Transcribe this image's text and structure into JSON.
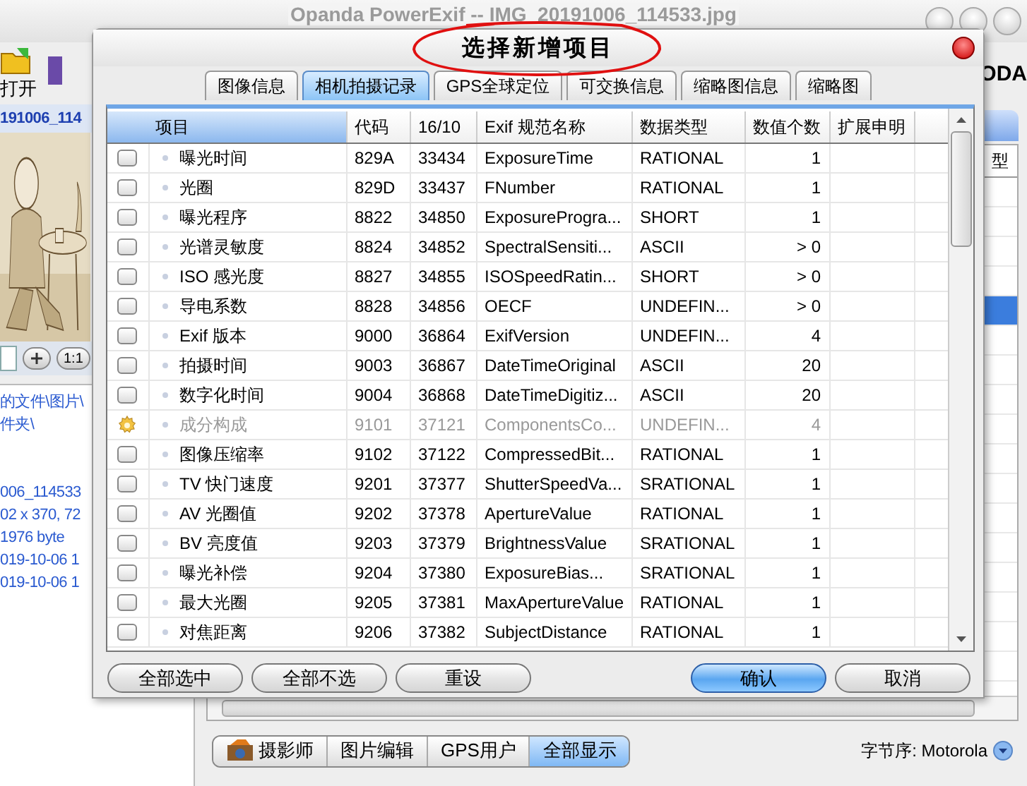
{
  "app_window": {
    "title": "Opanda PowerExif -- IMG_20191006_114533.jpg",
    "toolbar": [
      {
        "label": "打开"
      }
    ],
    "logo": "ODA",
    "file_name": "191006_114",
    "zoom_controls": [
      {
        "label": "1:1"
      }
    ],
    "file_path": [
      "的文件\\图片\\",
      "件夹\\"
    ],
    "file_details": [
      "006_114533",
      "02 x 370, 72",
      "1976 byte",
      "019-10-06 1",
      "019-10-06 1"
    ],
    "list_header": "型",
    "list_rows": [
      {
        "selected": false
      },
      {
        "selected": false
      },
      {
        "selected": false
      },
      {
        "selected": false
      },
      {
        "selected": true
      },
      {
        "selected": false
      },
      {
        "selected": false
      },
      {
        "selected": false
      },
      {
        "selected": false
      },
      {
        "selected": false
      },
      {
        "selected": false
      },
      {
        "selected": false
      },
      {
        "selected": false
      },
      {
        "selected": false
      },
      {
        "selected": false
      },
      {
        "selected": false
      },
      {
        "selected": false
      }
    ],
    "view_tabs": [
      {
        "label": "摄影师",
        "selected": false,
        "icon": true
      },
      {
        "label": "图片编辑",
        "selected": false,
        "icon": false
      },
      {
        "label": "GPS用户",
        "selected": false,
        "icon": false
      },
      {
        "label": "全部显示",
        "selected": true,
        "icon": false
      }
    ],
    "byte_order": "字节序: Motorola"
  },
  "dialog": {
    "title": "选择新增项目",
    "tabs": [
      {
        "label": "图像信息",
        "selected": false
      },
      {
        "label": "相机拍摄记录",
        "selected": true
      },
      {
        "label": "GPS全球定位",
        "selected": false
      },
      {
        "label": "可交换信息",
        "selected": false
      },
      {
        "label": "缩略图信息",
        "selected": false
      },
      {
        "label": "缩略图",
        "selected": false
      }
    ],
    "columns": [
      "项目",
      "代码",
      "16/10",
      "Exif 规范名称",
      "数据类型",
      "数值个数",
      "扩展申明"
    ],
    "rows": [
      {
        "item": "曝光时间",
        "code": "829A",
        "decimal": "33434",
        "exif_name": "ExposureTime",
        "data_type": "RATIONAL",
        "count": "1",
        "checked": false,
        "disabled": false
      },
      {
        "item": "光圈",
        "code": "829D",
        "decimal": "33437",
        "exif_name": "FNumber",
        "data_type": "RATIONAL",
        "count": "1",
        "checked": false,
        "disabled": false
      },
      {
        "item": "曝光程序",
        "code": "8822",
        "decimal": "34850",
        "exif_name": "ExposureProgra...",
        "data_type": "SHORT",
        "count": "1",
        "checked": false,
        "disabled": false
      },
      {
        "item": "光谱灵敏度",
        "code": "8824",
        "decimal": "34852",
        "exif_name": "SpectralSensiti...",
        "data_type": "ASCII",
        "count": "> 0",
        "checked": false,
        "disabled": false
      },
      {
        "item": "ISO 感光度",
        "code": "8827",
        "decimal": "34855",
        "exif_name": "ISOSpeedRatin...",
        "data_type": "SHORT",
        "count": "> 0",
        "checked": false,
        "disabled": false
      },
      {
        "item": "导电系数",
        "code": "8828",
        "decimal": "34856",
        "exif_name": "OECF",
        "data_type": "UNDEFIN...",
        "count": "> 0",
        "checked": false,
        "disabled": false
      },
      {
        "item": "Exif 版本",
        "code": "9000",
        "decimal": "36864",
        "exif_name": "ExifVersion",
        "data_type": "UNDEFIN...",
        "count": "4",
        "checked": false,
        "disabled": false
      },
      {
        "item": "拍摄时间",
        "code": "9003",
        "decimal": "36867",
        "exif_name": "DateTimeOriginal",
        "data_type": "ASCII",
        "count": "20",
        "checked": false,
        "disabled": false
      },
      {
        "item": "数字化时间",
        "code": "9004",
        "decimal": "36868",
        "exif_name": "DateTimeDigitiz...",
        "data_type": "ASCII",
        "count": "20",
        "checked": false,
        "disabled": false
      },
      {
        "item": "成分构成",
        "code": "9101",
        "decimal": "37121",
        "exif_name": "ComponentsCo...",
        "data_type": "UNDEFIN...",
        "count": "4",
        "checked": false,
        "disabled": true
      },
      {
        "item": "图像压缩率",
        "code": "9102",
        "decimal": "37122",
        "exif_name": "CompressedBit...",
        "data_type": "RATIONAL",
        "count": "1",
        "checked": false,
        "disabled": false
      },
      {
        "item": "TV 快门速度",
        "code": "9201",
        "decimal": "37377",
        "exif_name": "ShutterSpeedVa...",
        "data_type": "SRATIONAL",
        "count": "1",
        "checked": false,
        "disabled": false
      },
      {
        "item": "AV 光圈值",
        "code": "9202",
        "decimal": "37378",
        "exif_name": "ApertureValue",
        "data_type": "RATIONAL",
        "count": "1",
        "checked": false,
        "disabled": false
      },
      {
        "item": "BV 亮度值",
        "code": "9203",
        "decimal": "37379",
        "exif_name": "BrightnessValue",
        "data_type": "SRATIONAL",
        "count": "1",
        "checked": false,
        "disabled": false
      },
      {
        "item": "曝光补偿",
        "code": "9204",
        "decimal": "37380",
        "exif_name": "ExposureBias...",
        "data_type": "SRATIONAL",
        "count": "1",
        "checked": false,
        "disabled": false
      },
      {
        "item": "最大光圈",
        "code": "9205",
        "decimal": "37381",
        "exif_name": "MaxApertureValue",
        "data_type": "RATIONAL",
        "count": "1",
        "checked": false,
        "disabled": false
      },
      {
        "item": "对焦距离",
        "code": "9206",
        "decimal": "37382",
        "exif_name": "SubjectDistance",
        "data_type": "RATIONAL",
        "count": "1",
        "checked": false,
        "disabled": false
      }
    ],
    "buttons": [
      {
        "label": "全部选中",
        "default": false
      },
      {
        "label": "全部不选",
        "default": false
      },
      {
        "label": "重设",
        "default": false
      },
      {
        "label": "确认",
        "default": true
      },
      {
        "label": "取消",
        "default": false
      }
    ]
  }
}
